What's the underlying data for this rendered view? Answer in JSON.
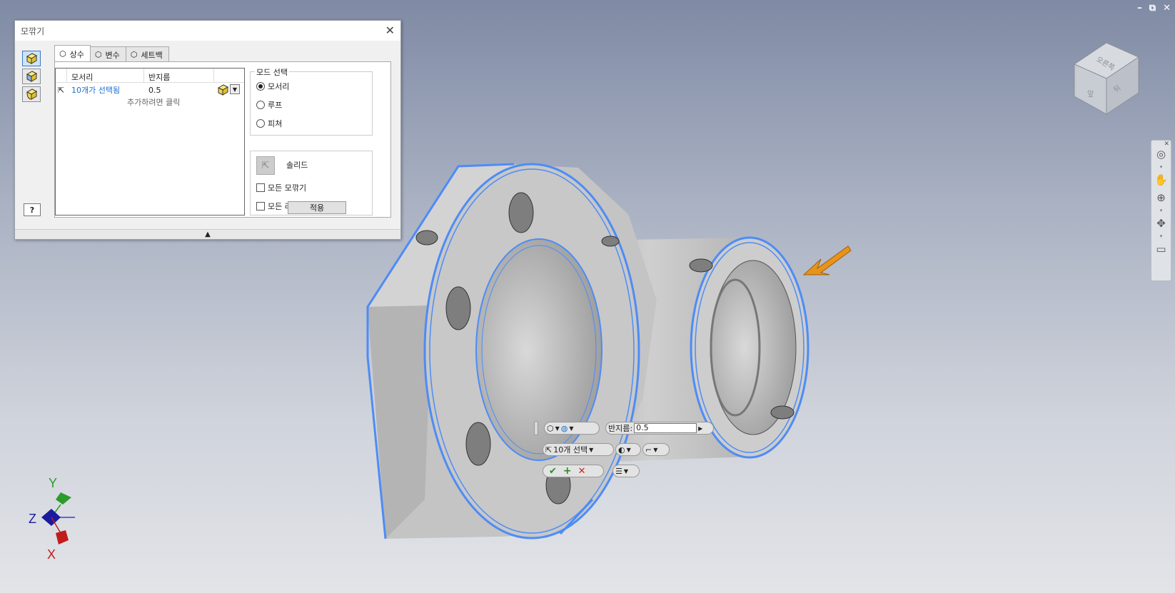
{
  "dialog": {
    "title": "모깎기",
    "tabs": [
      "상수",
      "변수",
      "세트백"
    ],
    "grid": {
      "col_edges": "모서리",
      "col_radius": "반지름",
      "row": {
        "edges": "10개가 선택됨",
        "radius": "0.5"
      },
      "add_hint": "추가하려면 클릭"
    },
    "mode": {
      "legend": "모드 선택",
      "options": [
        "모서리",
        "루프",
        "피쳐"
      ],
      "selected": "모서리"
    },
    "solid": {
      "label": "솔리드",
      "all_fillets": "모든 모깎기",
      "all_rounds": "모든 라",
      "apply": "적용"
    },
    "help": "?"
  },
  "minitoolbar": {
    "radius_label": "반지름:",
    "radius_value": "0.5",
    "selection": "10개 선택"
  },
  "axis": {
    "x": "X",
    "y": "Y",
    "z": "Z"
  },
  "window_controls": [
    "–",
    "⧉",
    "✕"
  ],
  "viewcube": {
    "top_label": "오른쪽",
    "front_label": "앞",
    "right_label": "뒤"
  },
  "colors": {
    "selection": "#4d8cf5",
    "arrow": "#e8931a",
    "part": "#bdbdbd"
  }
}
